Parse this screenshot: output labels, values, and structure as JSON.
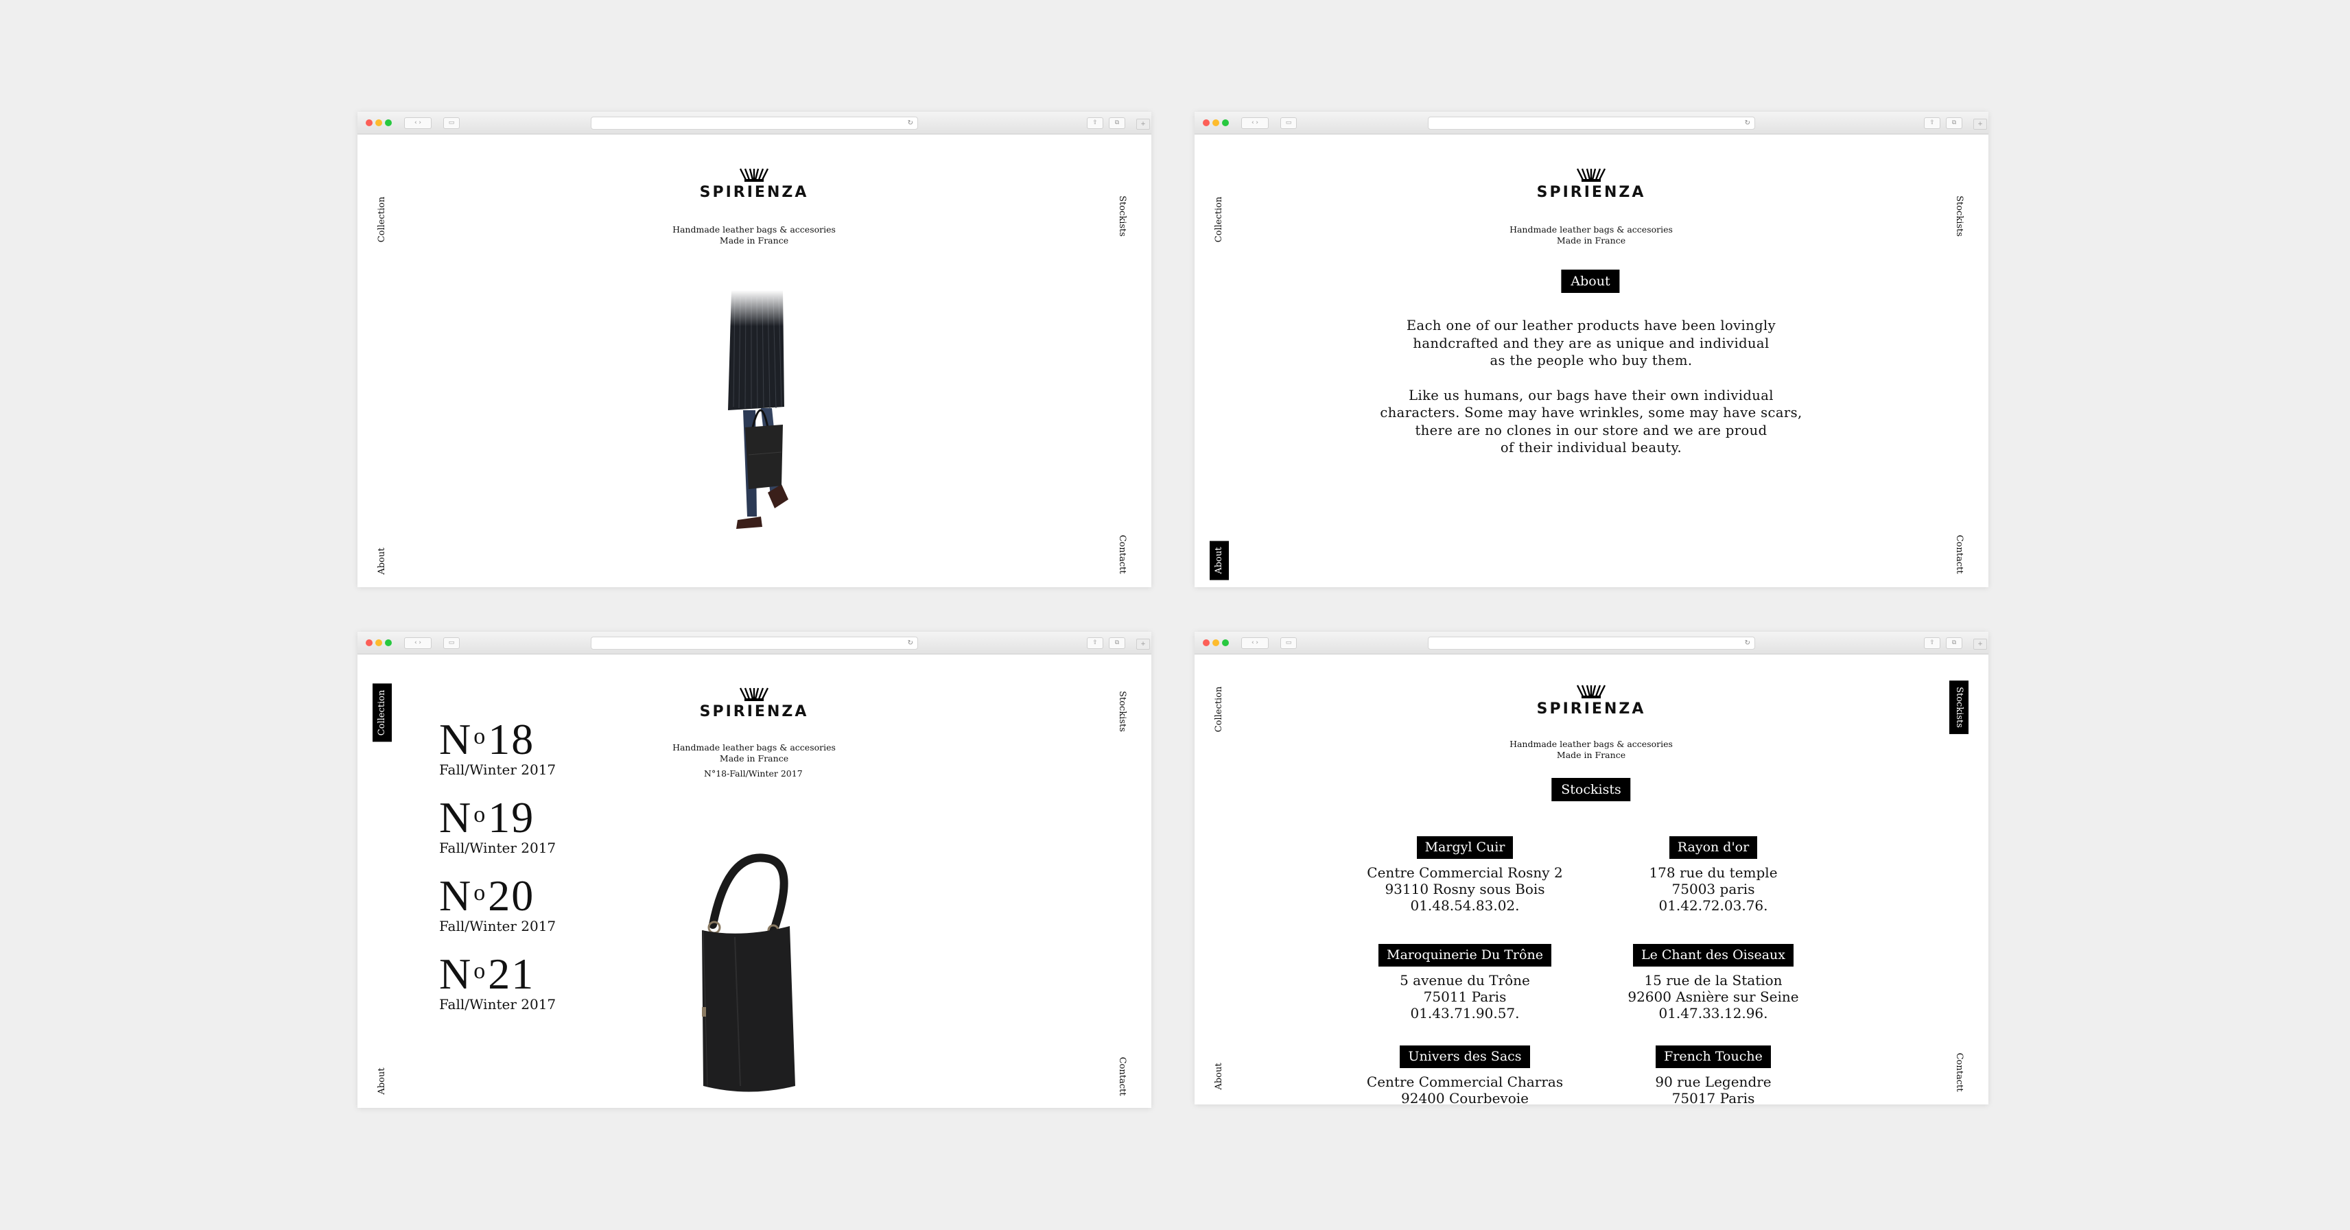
{
  "brand": {
    "name": "SPIRIENZA",
    "tagline_1": "Handmade leather bags & accesories",
    "tagline_2": "Made in France"
  },
  "nav": {
    "collection": "Collection",
    "stockists": "Stockists",
    "about": "About",
    "contact": "Contactt"
  },
  "browser": {
    "reload_icon": "↻",
    "plus": "+"
  },
  "about_page": {
    "title": "About",
    "paragraph_1": [
      "Each one of our leather products have been lovingly",
      "handcrafted and they are as unique and individual",
      "as the people who buy them."
    ],
    "paragraph_2": [
      "Like us humans, our bags have their own individual",
      "characters. Some may have wrinkles, some may have scars,",
      "there are no clones in our store and we are proud",
      "of their individual beauty."
    ]
  },
  "collection_page": {
    "current": "N°18-Fall/Winter 2017",
    "items": [
      {
        "number_prefix": "N",
        "number_sup": "o",
        "number": "18",
        "season": "Fall/Winter 2017"
      },
      {
        "number_prefix": "N",
        "number_sup": "o",
        "number": "19",
        "season": "Fall/Winter 2017"
      },
      {
        "number_prefix": "N",
        "number_sup": "o",
        "number": "20",
        "season": "Fall/Winter 2017"
      },
      {
        "number_prefix": "N",
        "number_sup": "o",
        "number": "21",
        "season": "Fall/Winter 2017"
      }
    ]
  },
  "stockists_page": {
    "title": "Stockists",
    "stores": [
      {
        "name": "Margyl Cuir",
        "lines": [
          "Centre Commercial Rosny 2",
          "93110 Rosny sous Bois",
          "01.48.54.83.02."
        ]
      },
      {
        "name": "Rayon d'or",
        "lines": [
          "178 rue du temple",
          "75003 paris",
          "01.42.72.03.76."
        ]
      },
      {
        "name": "Maroquinerie Du Trône",
        "lines": [
          "5 avenue du Trône",
          "75011 Paris",
          "01.43.71.90.57."
        ]
      },
      {
        "name": "Le Chant des Oiseaux",
        "lines": [
          "15 rue de la Station",
          "92600 Asnière sur Seine",
          "01.47.33.12.96."
        ]
      },
      {
        "name": "Univers des Sacs",
        "lines": [
          "Centre Commercial Charras",
          "92400 Courbevoie"
        ]
      },
      {
        "name": "French Touche",
        "lines": [
          "90 rue Legendre",
          "75017 Paris"
        ]
      }
    ]
  }
}
